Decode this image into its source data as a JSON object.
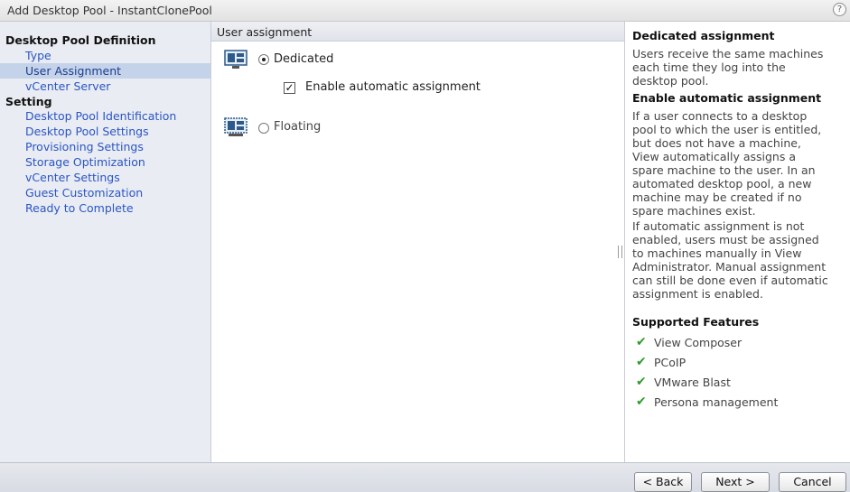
{
  "window": {
    "title": "Add Desktop Pool - InstantClonePool",
    "help_icon": "question-mark-icon",
    "help_glyph": "?"
  },
  "nav": {
    "section1": "Desktop Pool Definition",
    "section1_items": [
      "Type",
      "User Assignment",
      "vCenter Server"
    ],
    "section2": "Setting",
    "section2_items": [
      "Desktop Pool Identification",
      "Desktop Pool Settings",
      "Provisioning Settings",
      "Storage Optimization",
      "vCenter Settings",
      "Guest Customization",
      "Ready to Complete"
    ],
    "selected": "User Assignment"
  },
  "main": {
    "header": "User assignment",
    "options": {
      "dedicated": {
        "label": "Dedicated",
        "checked": true
      },
      "auto_assign": {
        "label": "Enable automatic assignment",
        "checked": true
      },
      "floating": {
        "label": "Floating",
        "checked": false
      }
    }
  },
  "help": {
    "dedicated_title": "Dedicated assignment",
    "dedicated_lines": [
      "Users receive the same machines",
      "each time they log into the",
      "desktop pool."
    ],
    "auto_title": "Enable automatic assignment",
    "auto_lines": [
      "If a user connects to a desktop",
      "pool to which the user is entitled,",
      "but does not have a machine,",
      "View automatically assigns a",
      "spare machine to the user. In an",
      "automated desktop pool, a new",
      "machine may be created if no",
      "spare machines exist."
    ],
    "manual_lines": [
      "If automatic assignment is not",
      "enabled, users must be assigned",
      "to machines manually in View",
      "Administrator. Manual assignment",
      "can still be done even if automatic",
      "assignment is enabled."
    ],
    "features_title": "Supported Features",
    "features": [
      "View Composer",
      "PCoIP",
      "VMware Blast",
      "Persona management"
    ]
  },
  "footer": {
    "back": "< Back",
    "next": "Next >",
    "cancel": "Cancel"
  },
  "colors": {
    "link": "#2a55c4",
    "selected_bg": "#c5d3ea",
    "check_green": "#2f9b2f",
    "pool_icon_blue": "#2d5a8c"
  }
}
